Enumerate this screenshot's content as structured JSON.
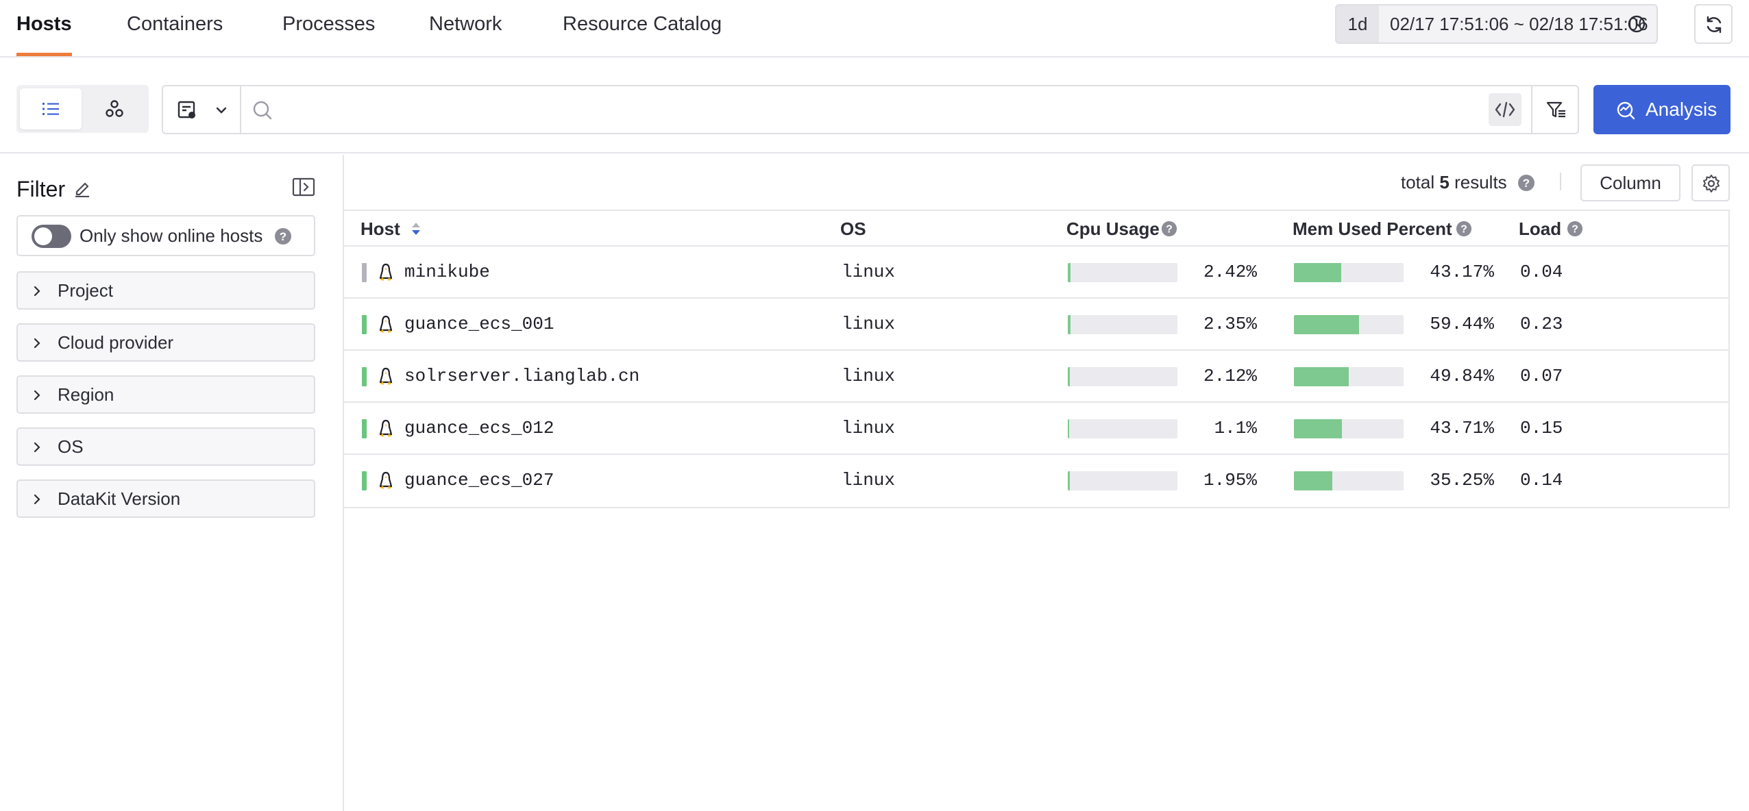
{
  "nav": {
    "tabs": [
      {
        "label": "Hosts",
        "active": true
      },
      {
        "label": "Containers",
        "active": false
      },
      {
        "label": "Processes",
        "active": false
      },
      {
        "label": "Network",
        "active": false
      },
      {
        "label": "Resource Catalog",
        "active": false
      }
    ],
    "time_period": "1d",
    "time_range": "02/17 17:51:06 ~ 02/18 17:51:06",
    "accent_color": "#ee7c3b"
  },
  "toolbar": {
    "search": {
      "value": "",
      "placeholder": ""
    },
    "analysis_label": "Analysis",
    "analysis_color": "#3c62d8"
  },
  "filter": {
    "title": "Filter",
    "online_label": "Only show online hosts",
    "online_enabled": false,
    "facets": [
      "Project",
      "Cloud provider",
      "Region",
      "OS",
      "DataKit Version"
    ]
  },
  "results": {
    "total_prefix": "total",
    "total_count": "5",
    "total_suffix": "results",
    "column_button": "Column"
  },
  "table": {
    "columns": [
      "Host",
      "OS",
      "Cpu Usage",
      "Mem Used Percent",
      "Load"
    ],
    "rows": [
      {
        "host": "minikube",
        "os": "linux",
        "cpu": "2.42%",
        "cpu_value": 2.42,
        "mem": "43.17%",
        "mem_value": 43.17,
        "load": "0.04",
        "status": "offline"
      },
      {
        "host": "guance_ecs_001",
        "os": "linux",
        "cpu": "2.35%",
        "cpu_value": 2.35,
        "mem": "59.44%",
        "mem_value": 59.44,
        "load": "0.23",
        "status": "online"
      },
      {
        "host": "solrserver.lianglab.cn",
        "os": "linux",
        "cpu": "2.12%",
        "cpu_value": 2.12,
        "mem": "49.84%",
        "mem_value": 49.84,
        "load": "0.07",
        "status": "online"
      },
      {
        "host": "guance_ecs_012",
        "os": "linux",
        "cpu": "1.1%",
        "cpu_value": 1.1,
        "mem": "43.71%",
        "mem_value": 43.71,
        "load": "0.15",
        "status": "online"
      },
      {
        "host": "guance_ecs_027",
        "os": "linux",
        "cpu": "1.95%",
        "cpu_value": 1.95,
        "mem": "35.25%",
        "mem_value": 35.25,
        "load": "0.14",
        "status": "online"
      }
    ],
    "status_colors": {
      "online": "#6cc57f",
      "offline": "#b4b4bc"
    }
  }
}
